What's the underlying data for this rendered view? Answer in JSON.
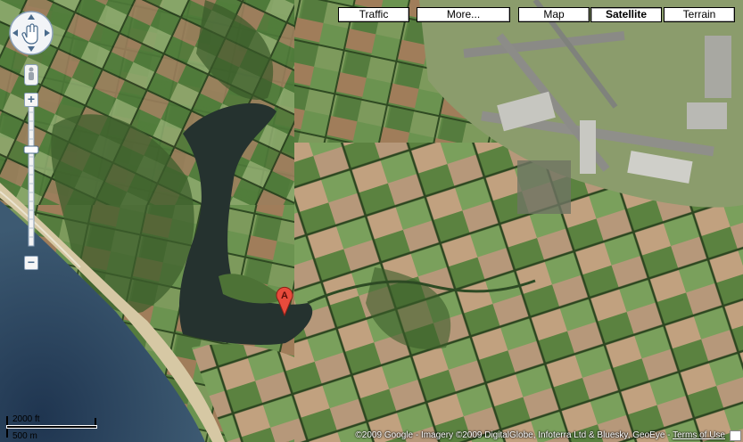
{
  "map_types": {
    "traffic": "Traffic",
    "more": "More...",
    "map": "Map",
    "satellite": "Satellite",
    "terrain": "Terrain",
    "selected": "Satellite"
  },
  "marker": {
    "label": "A",
    "color": "#e84b3c"
  },
  "scale": {
    "imperial": "2000 ft",
    "metric": "500 m"
  },
  "copyright": {
    "text": "©2009 Google - Imagery ©2009 DigitalGlobe, Infoterra Ltd & Bluesky, GeoEye - ",
    "terms_link": "Terms of Use"
  },
  "icons": {
    "pan": "pan-compass-icon",
    "pegman": "pegman-icon",
    "zoom_in": "+",
    "zoom_out": "−"
  },
  "colors": {
    "sea": "#2e4a63",
    "beach": "#d8c9a6",
    "reservoir": "#273534",
    "field_green": "#5f8a45",
    "field_brown": "#a87f5c",
    "field_tan": "#b89a6e"
  }
}
